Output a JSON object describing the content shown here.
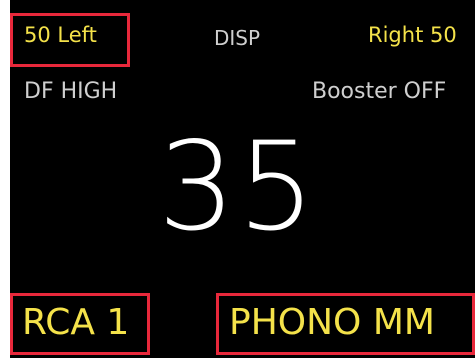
{
  "header": {
    "left_balance": "50 Left",
    "display_button": "DISP",
    "right_balance": "Right 50"
  },
  "status": {
    "df_mode": "DF HIGH",
    "booster": "Booster OFF"
  },
  "volume": {
    "value": "35"
  },
  "inputs": {
    "left": "RCA 1",
    "right": "PHONO MM"
  },
  "colors": {
    "background": "#000000",
    "highlight_text": "#f4e24a",
    "secondary_text": "#cfcfcf",
    "primary_text": "#ffffff",
    "annotation_box": "#e8283b"
  }
}
